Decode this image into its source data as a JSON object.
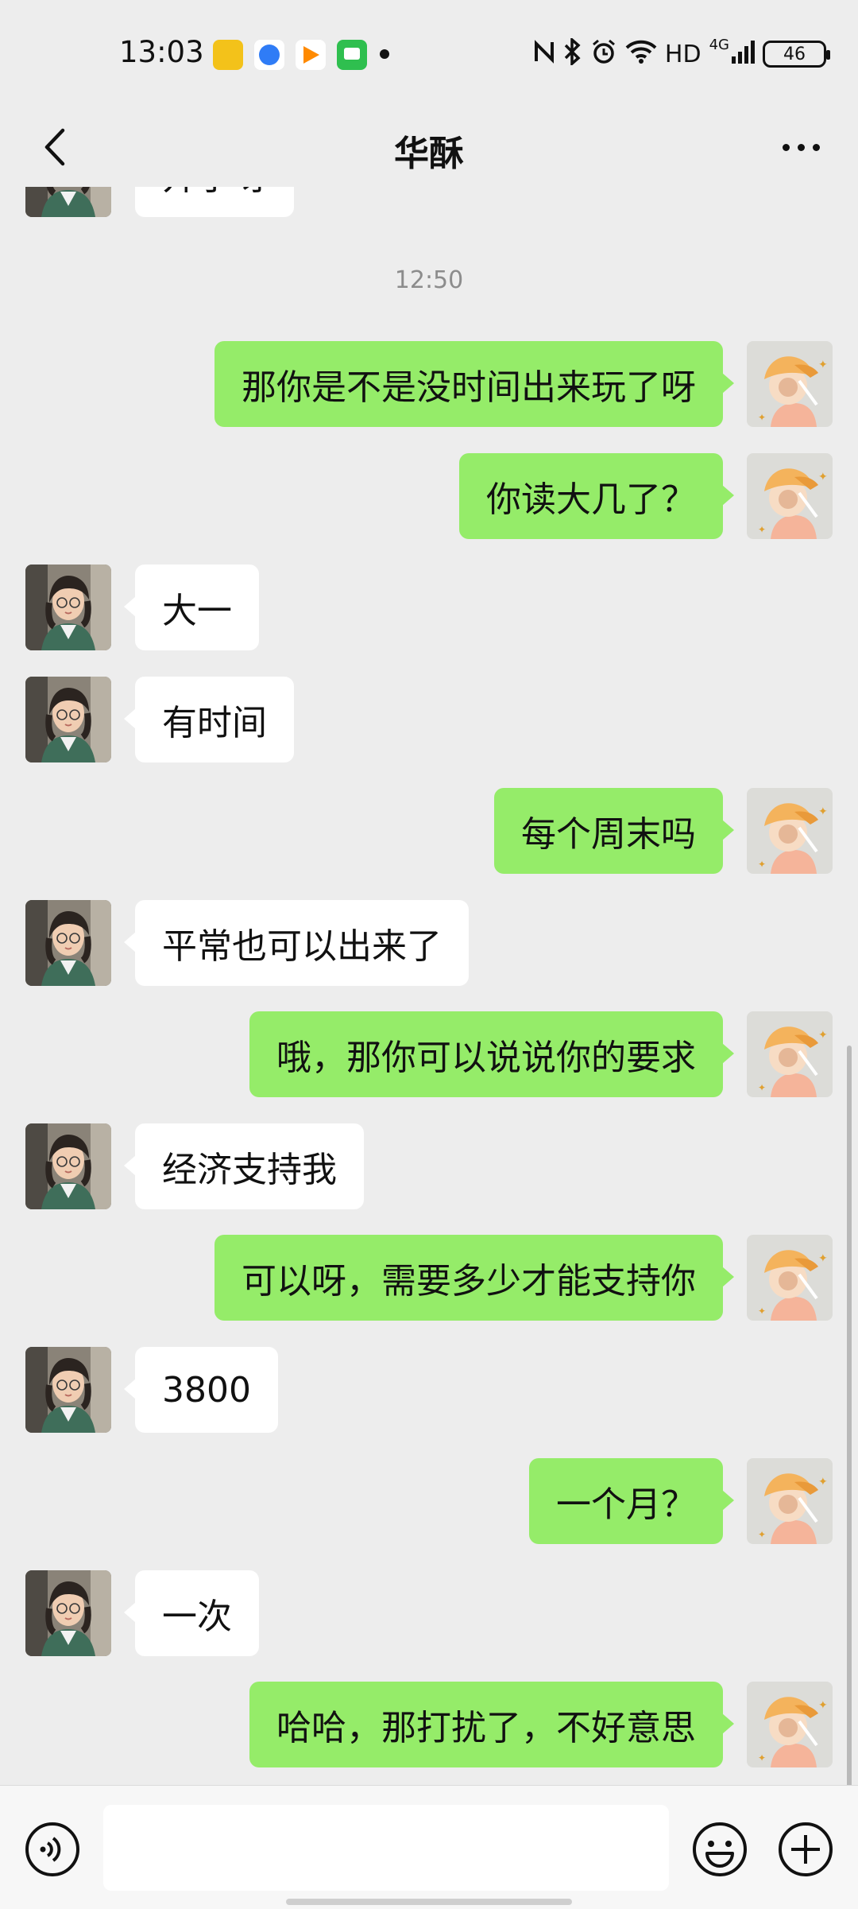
{
  "status_bar": {
    "time": "13:03",
    "network_label": "HD",
    "signal_label": "4G",
    "battery": "46",
    "icons": [
      "nfc-icon",
      "bluetooth-icon",
      "alarm-icon",
      "wifi-icon",
      "signal-icon"
    ]
  },
  "header": {
    "title": "华酥"
  },
  "chat": {
    "top_partial_text": "开了呀",
    "time_separator": "12:50",
    "messages": [
      {
        "side": "out",
        "text": "那你是不是没时间出来玩了呀"
      },
      {
        "side": "out",
        "text": "你读大几了？"
      },
      {
        "side": "in",
        "text": "大一"
      },
      {
        "side": "in",
        "text": "有时间"
      },
      {
        "side": "out",
        "text": "每个周末吗"
      },
      {
        "side": "in",
        "text": "平常也可以出来了"
      },
      {
        "side": "out",
        "text": "哦，那你可以说说你的要求"
      },
      {
        "side": "in",
        "text": "经济支持我"
      },
      {
        "side": "out",
        "text": "可以呀，需要多少才能支持你"
      },
      {
        "side": "in",
        "text": "3800"
      },
      {
        "side": "out",
        "text": "一个月？"
      },
      {
        "side": "in",
        "text": "一次"
      },
      {
        "side": "out",
        "text": "哈哈，那打扰了，不好意思"
      }
    ]
  },
  "input_bar": {
    "placeholder": ""
  },
  "colors": {
    "background": "#ededed",
    "outgoing_bubble": "#95ec69",
    "incoming_bubble": "#ffffff"
  }
}
